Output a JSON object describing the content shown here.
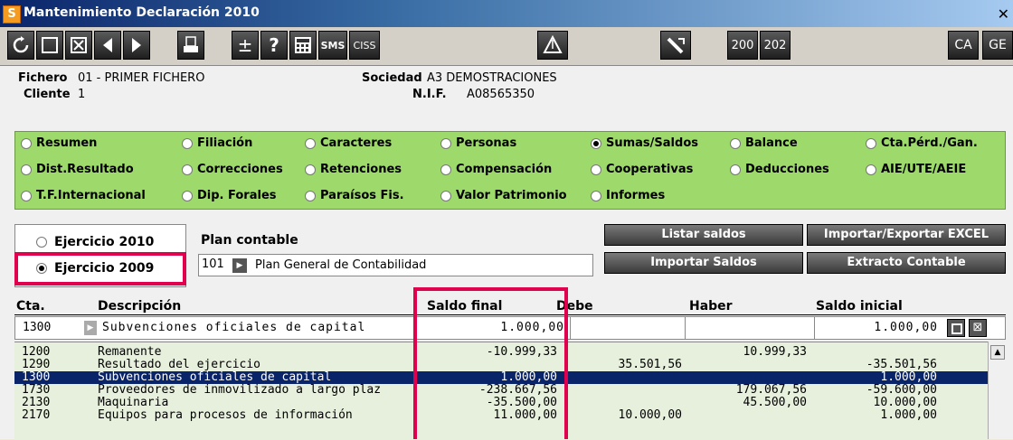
{
  "window": {
    "title": "Mantenimiento Declaración 2010",
    "app_icon": "S"
  },
  "toolbar": {
    "sms": "SMS",
    "ciss": "CISS",
    "b200": "200",
    "b202": "202",
    "ca": "CA",
    "ge": "GE"
  },
  "info": {
    "fichero_label": "Fichero",
    "fichero_value": "01 - PRIMER FICHERO",
    "cliente_label": "Cliente",
    "cliente_value": "1",
    "sociedad_label": "Sociedad",
    "sociedad_value": "A3 DEMOSTRACIONES",
    "nif_label": "N.I.F.",
    "nif_value": "A08565350"
  },
  "sections": [
    {
      "label": "Resumen",
      "selected": false
    },
    {
      "label": "Filiación",
      "selected": false
    },
    {
      "label": "Caracteres",
      "selected": false
    },
    {
      "label": "Personas",
      "selected": false
    },
    {
      "label": "Sumas/Saldos",
      "selected": true
    },
    {
      "label": "Balance",
      "selected": false
    },
    {
      "label": "Cta.Pérd./Gan.",
      "selected": false
    },
    {
      "label": "Dist.Resultado",
      "selected": false
    },
    {
      "label": "Correcciones",
      "selected": false
    },
    {
      "label": "Retenciones",
      "selected": false
    },
    {
      "label": "Compensación",
      "selected": false
    },
    {
      "label": "Cooperativas",
      "selected": false
    },
    {
      "label": "Deducciones",
      "selected": false
    },
    {
      "label": "AIE/UTE/AEIE",
      "selected": false
    },
    {
      "label": "T.F.Internacional",
      "selected": false
    },
    {
      "label": "Dip. Forales",
      "selected": false
    },
    {
      "label": "Paraísos Fis.",
      "selected": false
    },
    {
      "label": "Valor Patrimonio",
      "selected": false
    },
    {
      "label": "Informes",
      "selected": false
    }
  ],
  "ejercicio": [
    {
      "label": "Ejercicio 2010",
      "selected": false
    },
    {
      "label": "Ejercicio 2009",
      "selected": true
    }
  ],
  "plan": {
    "label": "Plan contable",
    "code": "101",
    "name": "Plan General de Contabilidad"
  },
  "buttons": {
    "listar": "Listar saldos",
    "importar_excel": "Importar/Exportar EXCEL",
    "importar_saldos": "Importar Saldos",
    "extracto": "Extracto Contable"
  },
  "table": {
    "headers": {
      "cta": "Cta.",
      "desc": "Descripción",
      "saldo_final": "Saldo final",
      "debe": "Debe",
      "haber": "Haber",
      "saldo_inicial": "Saldo inicial"
    },
    "input": {
      "cta": "1300",
      "desc": "Subvenciones oficiales de capital",
      "saldo_final": "1.000,00",
      "saldo_inicial": "1.000,00"
    },
    "rows": [
      {
        "cta": "1200",
        "desc": "Remanente",
        "saldo_final": "-10.999,33",
        "debe": "",
        "haber": "10.999,33",
        "saldo_inicial": ""
      },
      {
        "cta": "1290",
        "desc": "Resultado del ejercicio",
        "saldo_final": "",
        "debe": "35.501,56",
        "haber": "",
        "saldo_inicial": "-35.501,56"
      },
      {
        "cta": "1300",
        "desc": "Subvenciones oficiales de capital",
        "saldo_final": "1.000,00",
        "debe": "",
        "haber": "",
        "saldo_inicial": "1.000,00"
      },
      {
        "cta": "1730",
        "desc": "Proveedores de inmovilizado a largo plaz",
        "saldo_final": "-238.667,56",
        "debe": "",
        "haber": "179.067,56",
        "saldo_inicial": "-59.600,00"
      },
      {
        "cta": "2130",
        "desc": "Maquinaria",
        "saldo_final": "-35.500,00",
        "debe": "",
        "haber": "45.500,00",
        "saldo_inicial": "10.000,00"
      },
      {
        "cta": "2170",
        "desc": "Equipos para procesos de información",
        "saldo_final": "11.000,00",
        "debe": "10.000,00",
        "haber": "",
        "saldo_inicial": "1.000,00"
      }
    ]
  }
}
